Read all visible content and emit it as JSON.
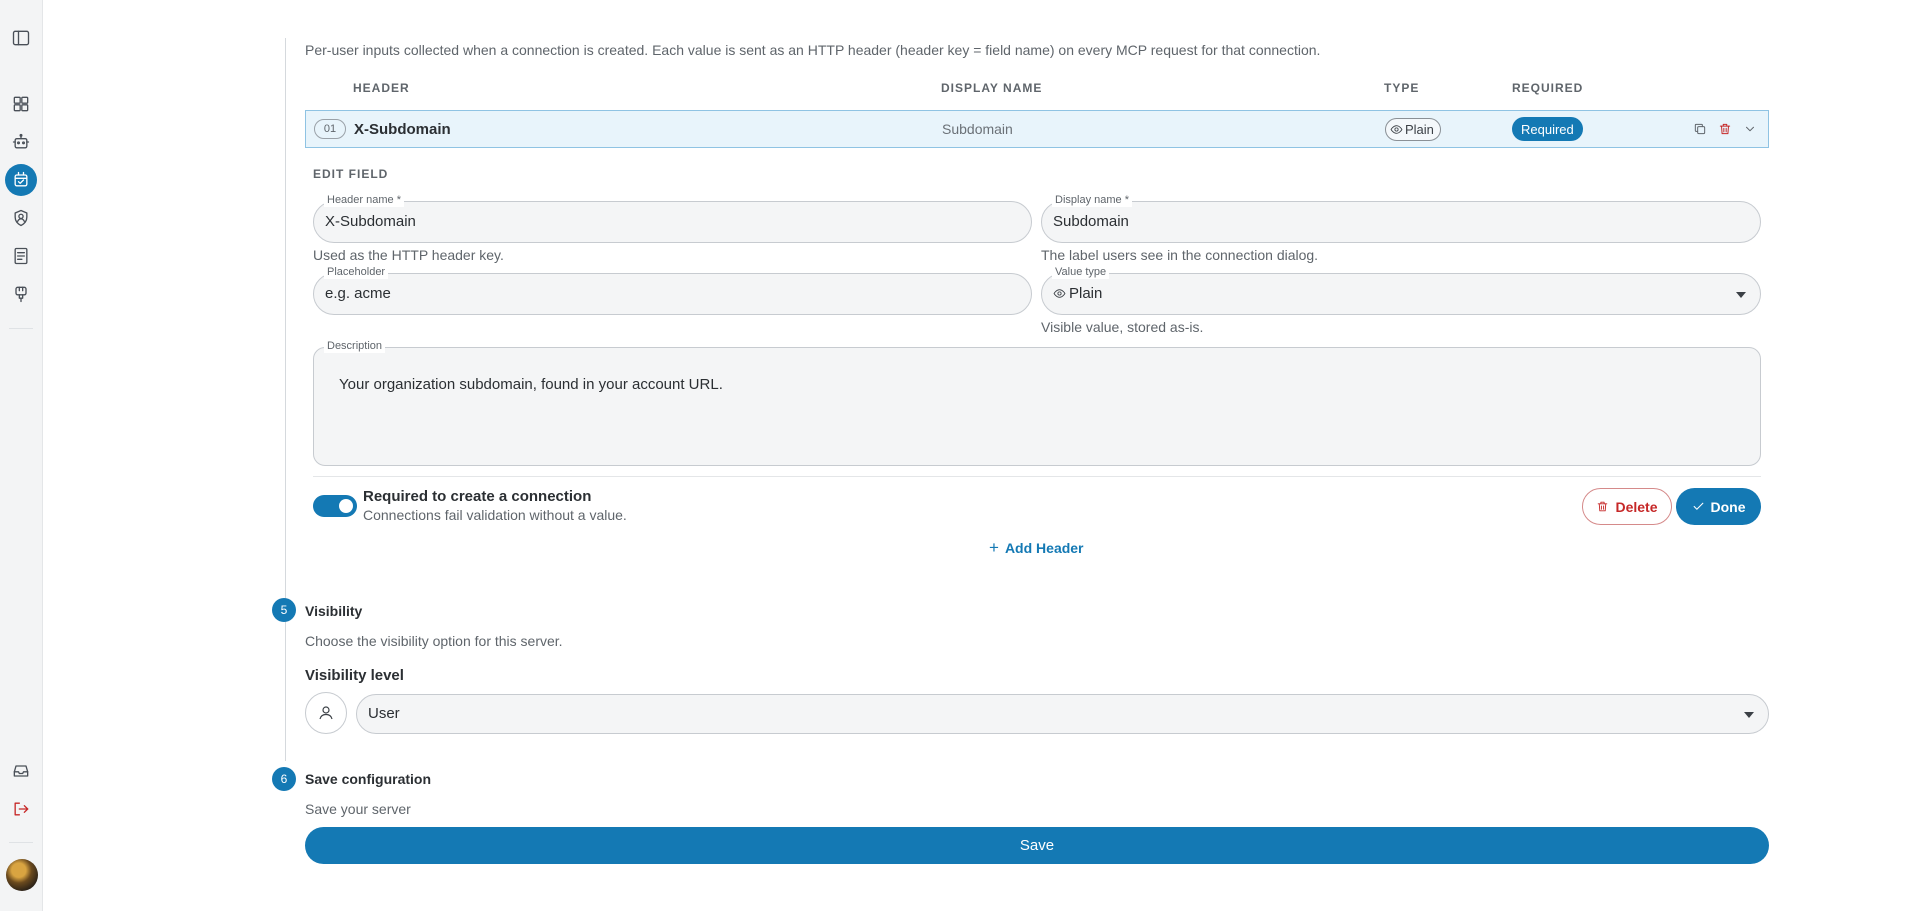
{
  "colors": {
    "accent": "#1479b4",
    "danger": "#c62828"
  },
  "sidebar": {
    "icons": [
      "sidebar-toggle-icon",
      "dashboard-icon",
      "robot-icon",
      "mcp-servers-icon",
      "shield-user-icon",
      "book-icon",
      "plug-icon",
      "inbox-icon",
      "logout-icon"
    ]
  },
  "headers_section": {
    "intro": "Per-user inputs collected when a connection is created. Each value is sent as an HTTP header (header key = field name) on every MCP request for that connection.",
    "columns": {
      "header": "HEADER",
      "display_name": "DISPLAY NAME",
      "type": "TYPE",
      "required": "REQUIRED"
    },
    "rows": [
      {
        "index": "01",
        "header": "X-Subdomain",
        "display_name": "Subdomain",
        "type": "Plain",
        "required": "Required"
      }
    ],
    "edit": {
      "title": "EDIT FIELD",
      "header_name": {
        "label": "Header name *",
        "value": "X-Subdomain",
        "help": "Used as the HTTP header key."
      },
      "display_name": {
        "label": "Display name *",
        "value": "Subdomain",
        "help": "The label users see in the connection dialog."
      },
      "placeholder": {
        "label": "Placeholder",
        "value": "e.g. acme"
      },
      "value_type": {
        "label": "Value type",
        "value": "Plain",
        "help": "Visible value, stored as-is."
      },
      "description": {
        "label": "Description",
        "value": "Your organization subdomain, found in your account URL."
      },
      "required_toggle": {
        "on": true,
        "title": "Required to create a connection",
        "subtitle": "Connections fail validation without a value."
      },
      "delete_label": "Delete",
      "done_label": "Done"
    },
    "add_header_label": "Add Header"
  },
  "visibility": {
    "step": "5",
    "title": "Visibility",
    "subtitle": "Choose the visibility option for this server.",
    "level_label": "Visibility level",
    "value": "User"
  },
  "save_step": {
    "step": "6",
    "title": "Save configuration",
    "subtitle": "Save your server",
    "button_label": "Save"
  }
}
